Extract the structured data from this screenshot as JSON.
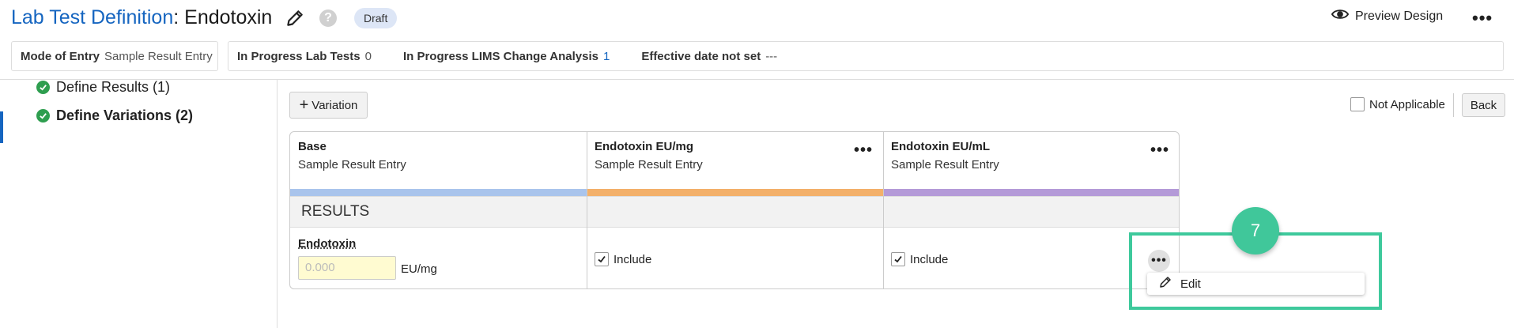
{
  "header": {
    "title_prefix": "Lab Test Definition",
    "title_sep": ": ",
    "title_name": "Endotoxin",
    "status_badge": "Draft",
    "preview_label": "Preview Design",
    "help_glyph": "?"
  },
  "info_bar": {
    "mode_label": "Mode of Entry",
    "mode_value": "Sample Result Entry",
    "in_progress_tests_label": "In Progress Lab Tests",
    "in_progress_tests_value": "0",
    "lims_label": "In Progress LIMS Change Analysis",
    "lims_value": "1",
    "effective_label": "Effective date not set",
    "effective_value": "---"
  },
  "sidebar": {
    "items": [
      {
        "label": "Define Results (1)",
        "active": false
      },
      {
        "label": "Define Variations (2)",
        "active": true
      }
    ]
  },
  "toolbar": {
    "variation_label": "Variation",
    "not_applicable_label": "Not Applicable",
    "back_label": "Back"
  },
  "grid": {
    "columns": [
      {
        "title": "Base",
        "subtitle": "Sample Result Entry",
        "color": "#a9c4ec"
      },
      {
        "title": "Endotoxin EU/mg",
        "subtitle": "Sample Result Entry",
        "color": "#f3b06a"
      },
      {
        "title": "Endotoxin EU/mL",
        "subtitle": "Sample Result Entry",
        "color": "#b49ad8"
      }
    ],
    "section_title": "RESULTS",
    "result": {
      "name": "Endotoxin",
      "placeholder": "0.000",
      "unit": "EU/mg",
      "include_label": "Include"
    }
  },
  "row_menu": {
    "edit_label": "Edit"
  },
  "step_marker": "7",
  "colors": {
    "accent": "#1565c0",
    "success": "#2e9e4f",
    "highlight": "#3ec99c"
  },
  "icons": [
    "pencil-icon",
    "help-icon",
    "eye-icon",
    "more-icon",
    "check-circle-icon",
    "plus-icon",
    "checkbox-icon"
  ]
}
